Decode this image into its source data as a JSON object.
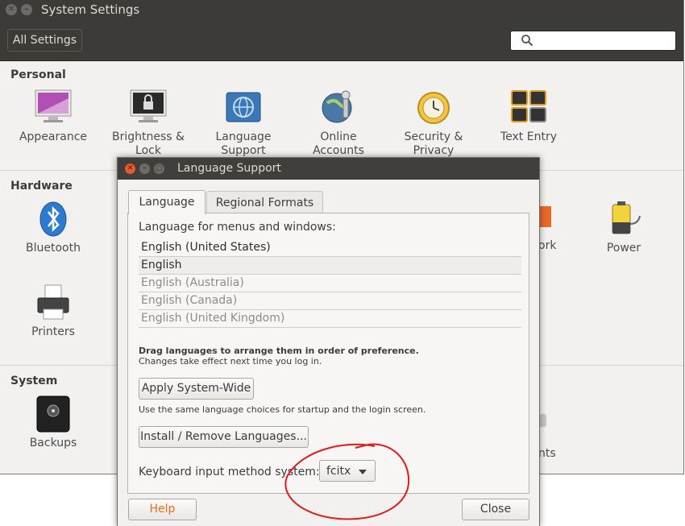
{
  "settings": {
    "title": "System Settings",
    "all_settings": "All Settings",
    "sections": {
      "personal": "Personal",
      "hardware": "Hardware",
      "system": "System"
    },
    "personal_items": [
      {
        "label": "Appearance"
      },
      {
        "label": "Brightness &\nLock"
      },
      {
        "label": "Language\nSupport"
      },
      {
        "label": "Online\nAccounts"
      },
      {
        "label": "Security &\nPrivacy"
      },
      {
        "label": "Text Entry"
      }
    ],
    "hardware_items": [
      {
        "label": "Bluetooth"
      },
      {
        "label": "Power"
      },
      {
        "label": "Printers"
      }
    ],
    "partial_labels": {
      "network_fragment": "ork",
      "system_fragment": "nts"
    },
    "system_items": [
      {
        "label": "Backups"
      }
    ]
  },
  "dialog": {
    "title": "Language Support",
    "tabs": [
      {
        "label": "Language"
      },
      {
        "label": "Regional Formats"
      }
    ],
    "language_heading": "Language for menus and windows:",
    "languages": [
      {
        "label": "English (United States)"
      },
      {
        "label": "English"
      },
      {
        "label": "English (Australia)"
      },
      {
        "label": "English (Canada)"
      },
      {
        "label": "English (United Kingdom)"
      }
    ],
    "drag_note": "Drag languages to arrange them in order of preference.",
    "change_note": "Changes take effect next time you log in.",
    "apply_button": "Apply System-Wide",
    "same_note": "Use the same language choices for startup and the login screen.",
    "install_button": "Install / Remove Languages...",
    "keyboard_label": "Keyboard input method system:",
    "keyboard_value": "fcitx",
    "help_button": "Help",
    "close_button": "Close"
  }
}
